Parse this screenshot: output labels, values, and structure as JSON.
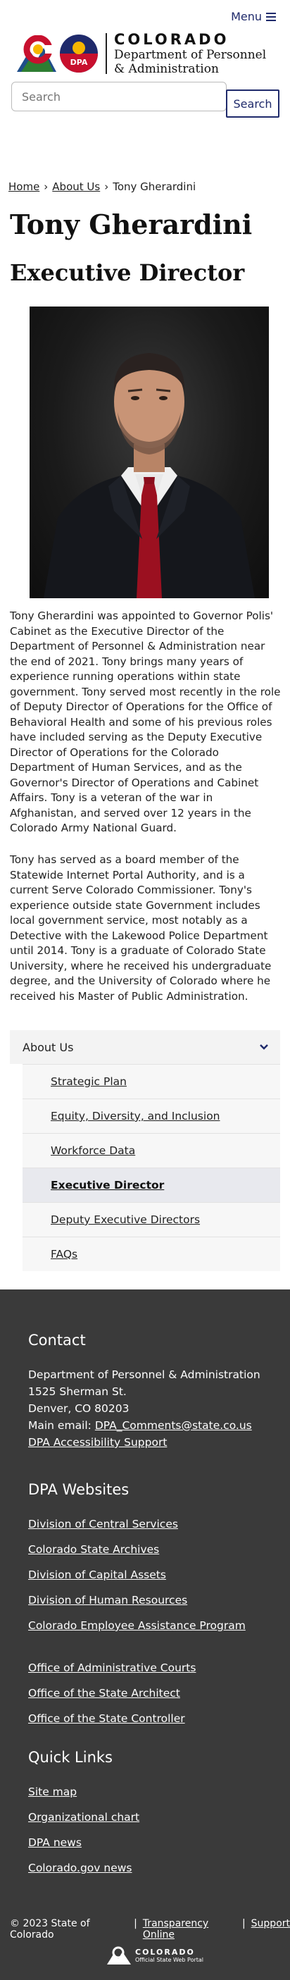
{
  "header": {
    "menu_label": "Menu",
    "logo_line1": "COLORADO",
    "logo_line2": "Department of Personnel",
    "logo_line3": "& Administration",
    "dpa_badge": "DPA"
  },
  "search": {
    "placeholder": "Search",
    "button_label": "Search"
  },
  "breadcrumb": {
    "home": "Home",
    "about": "About Us",
    "current": "Tony Gherardini",
    "separator": "›"
  },
  "page": {
    "name": "Tony Gherardini",
    "role": "Executive Director"
  },
  "bio": {
    "paragraph1": "Tony Gherardini was appointed to Governor Polis' Cabinet as the Executive Director of the Department of Personnel & Administration near the end of 2021. Tony brings many years of experience running operations within state government. Tony served most recently in the role of Deputy Director of Operations for the Office of Behavioral Health and some of his previous roles have included serving as the Deputy Executive Director of Operations for the Colorado Department of Human Services, and as the Governor's Director of Operations and Cabinet Affairs. Tony is a veteran of the war in Afghanistan, and served over 12 years in the Colorado Army National Guard.",
    "paragraph2": "Tony has served as a board member of the Statewide Internet Portal Authority, and is a current Serve Colorado Commissioner. Tony's experience outside state Government includes local government service, most notably as a Detective with the Lakewood Police Department until 2014. Tony is a graduate of Colorado State University, where he received his undergraduate degree, and the University of Colorado where he received his Master of Public Administration."
  },
  "sidenav": {
    "heading": "About Us",
    "items": [
      {
        "label": "Strategic Plan"
      },
      {
        "label": "Equity, Diversity, and Inclusion"
      },
      {
        "label": "Workforce Data"
      },
      {
        "label": "Executive Director"
      },
      {
        "label": "Deputy Executive Directors"
      },
      {
        "label": "FAQs"
      }
    ]
  },
  "footer": {
    "contact_heading": "Contact",
    "address": [
      "Department of Personnel & Administration",
      "1525 Sherman St.",
      "Denver, CO 80203"
    ],
    "email_prefix": "Main email: ",
    "email": "DPA_Comments@state.co.us",
    "accessibility": "DPA Accessibility Support",
    "websites_heading": "DPA Websites",
    "websites": [
      "Division of Central Services",
      "Colorado State Archives",
      "Division of Capital Assets",
      "Division of Human Resources",
      "Colorado Employee Assistance Program"
    ],
    "offices": [
      "Office of Administrative Courts",
      "Office of the State Architect",
      "Office of the State Controller"
    ],
    "quick_heading": "Quick Links",
    "quick_links": [
      "Site map",
      "Organizational chart",
      "DPA news",
      "Colorado.gov news"
    ],
    "copyright": "© 2023 State of Colorado",
    "legal_sep": "|",
    "transparency": "Transparency Online",
    "support": "Support",
    "portal_line1": "COLORADO",
    "portal_line2": "Official State Web Portal"
  },
  "colors": {
    "brand_navy": "#1f2a6b",
    "footer_bg": "#3a3a3a",
    "active_nav": "#e8e9ee"
  },
  "icons": [
    "menu-icon",
    "colorado-logo-icon",
    "dpa-logo-icon",
    "chevron-down-icon",
    "colorado-portal-icon"
  ]
}
